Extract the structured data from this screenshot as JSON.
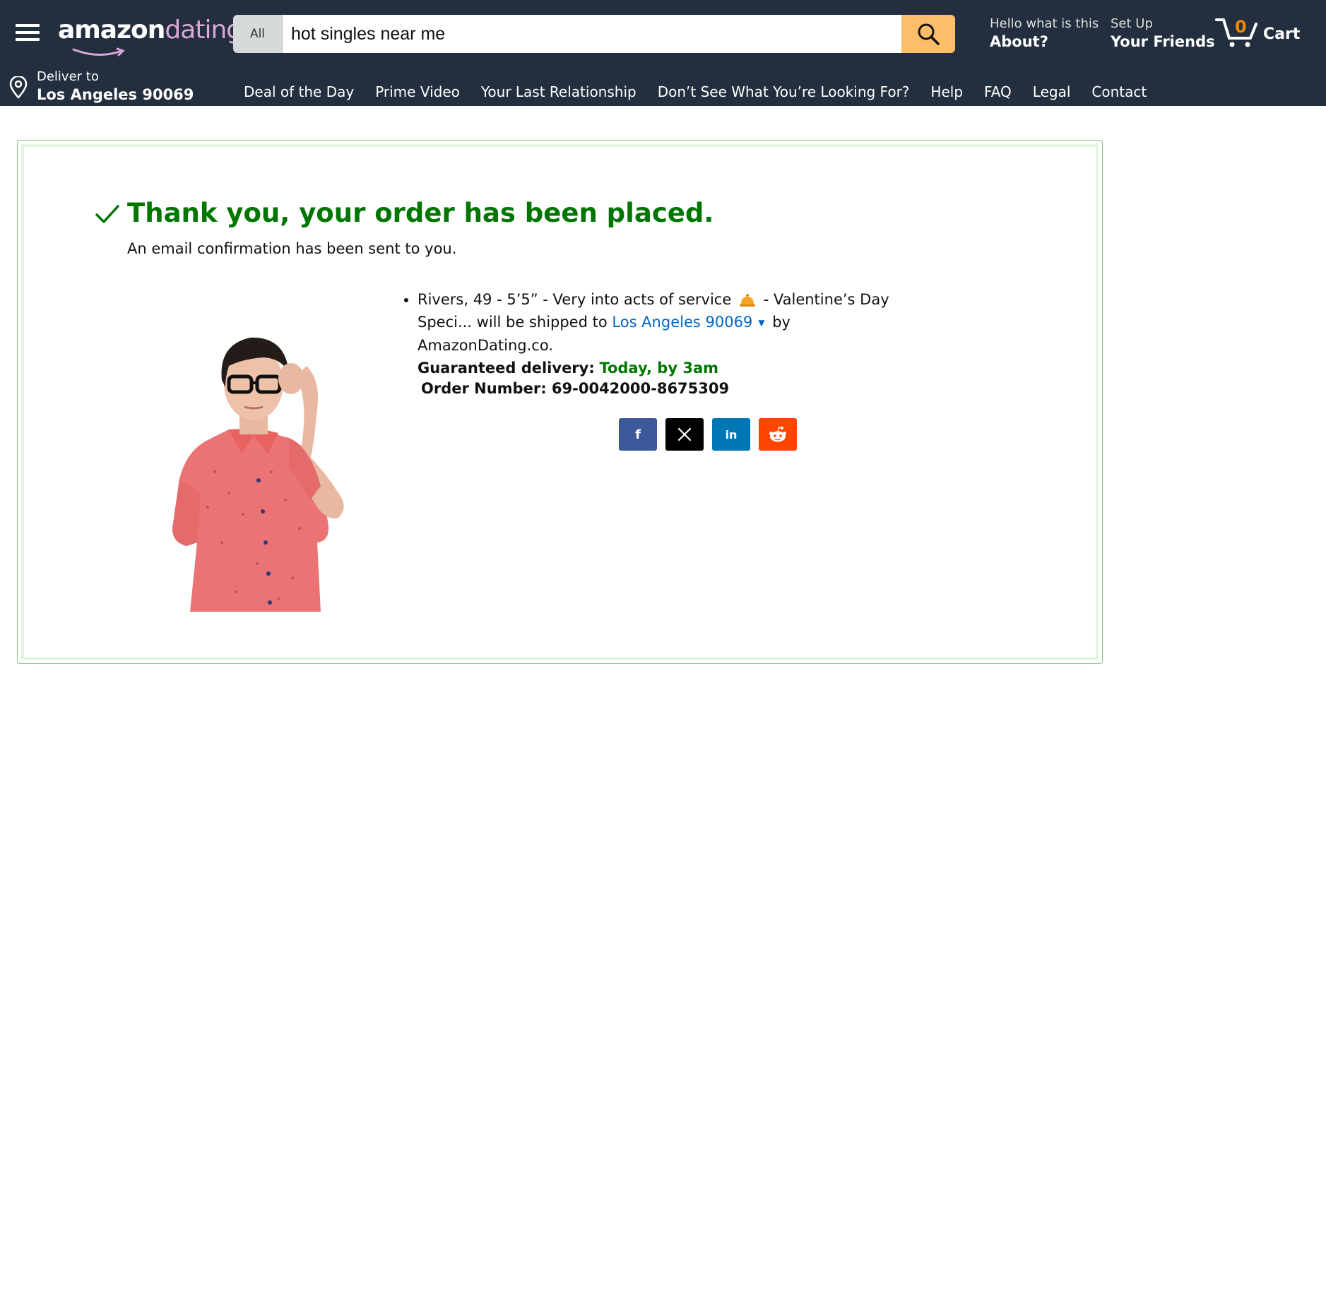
{
  "header": {
    "logo_part1": "amazon",
    "logo_part2": "dating",
    "search": {
      "category": "All",
      "value": "hot singles near me",
      "placeholder": ""
    },
    "about_small": "Hello what is this",
    "about_big": "About?",
    "friends_small": "Set Up",
    "friends_big": "Your Friends",
    "cart_count": "0",
    "cart_label": "Cart",
    "deliver_small": "Deliver to",
    "deliver_big": "Los Angeles 90069",
    "nav": [
      "Deal of the Day",
      "Prime Video",
      "Your Last Relationship",
      "Don’t See What You’re Looking For?",
      "Help",
      "FAQ",
      "Legal",
      "Contact"
    ]
  },
  "confirmation": {
    "title": "Thank you, your order has been placed.",
    "subtitle": "An email confirmation has been sent to you.",
    "item_part1": "Rivers, 49 - 5’5” - Very into acts of service",
    "item_part2": "- Valentine’s Day Speci... will be shipped to",
    "ship_to": "Los Angeles 90069",
    "by_text": "by AmazonDating.co.",
    "delivery_label": "Guaranteed delivery:",
    "delivery_value": "Today, by 3am",
    "order_number": "Order Number: 69-0042000-8675309"
  },
  "share": {
    "facebook": "f",
    "linkedin": "in"
  },
  "colors": {
    "header_bg": "#232f3e",
    "search_button": "#febd69",
    "success_green": "#007600",
    "link_blue": "#0066c0",
    "cart_count": "#f08804",
    "logo_pink": "#d9a7d8"
  }
}
